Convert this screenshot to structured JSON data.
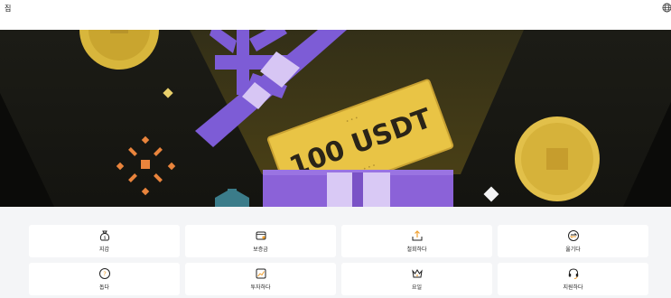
{
  "header": {
    "home_label": "집",
    "language_icon": "globe-icon"
  },
  "banner": {
    "coupon_text": "100 USDT",
    "slide_count": 3,
    "active_slide": 1
  },
  "menu": [
    {
      "label": "지갑",
      "icon": "wallet-bag-icon"
    },
    {
      "label": "보증금",
      "icon": "deposit-icon"
    },
    {
      "label": "철회하다",
      "icon": "withdraw-icon"
    },
    {
      "label": "옮기다",
      "icon": "transfer-icon"
    },
    {
      "label": "돕다",
      "icon": "help-icon"
    },
    {
      "label": "투자하다",
      "icon": "invest-chart-icon"
    },
    {
      "label": "요일",
      "icon": "crown-icon"
    },
    {
      "label": "지원하다",
      "icon": "headset-icon"
    }
  ]
}
